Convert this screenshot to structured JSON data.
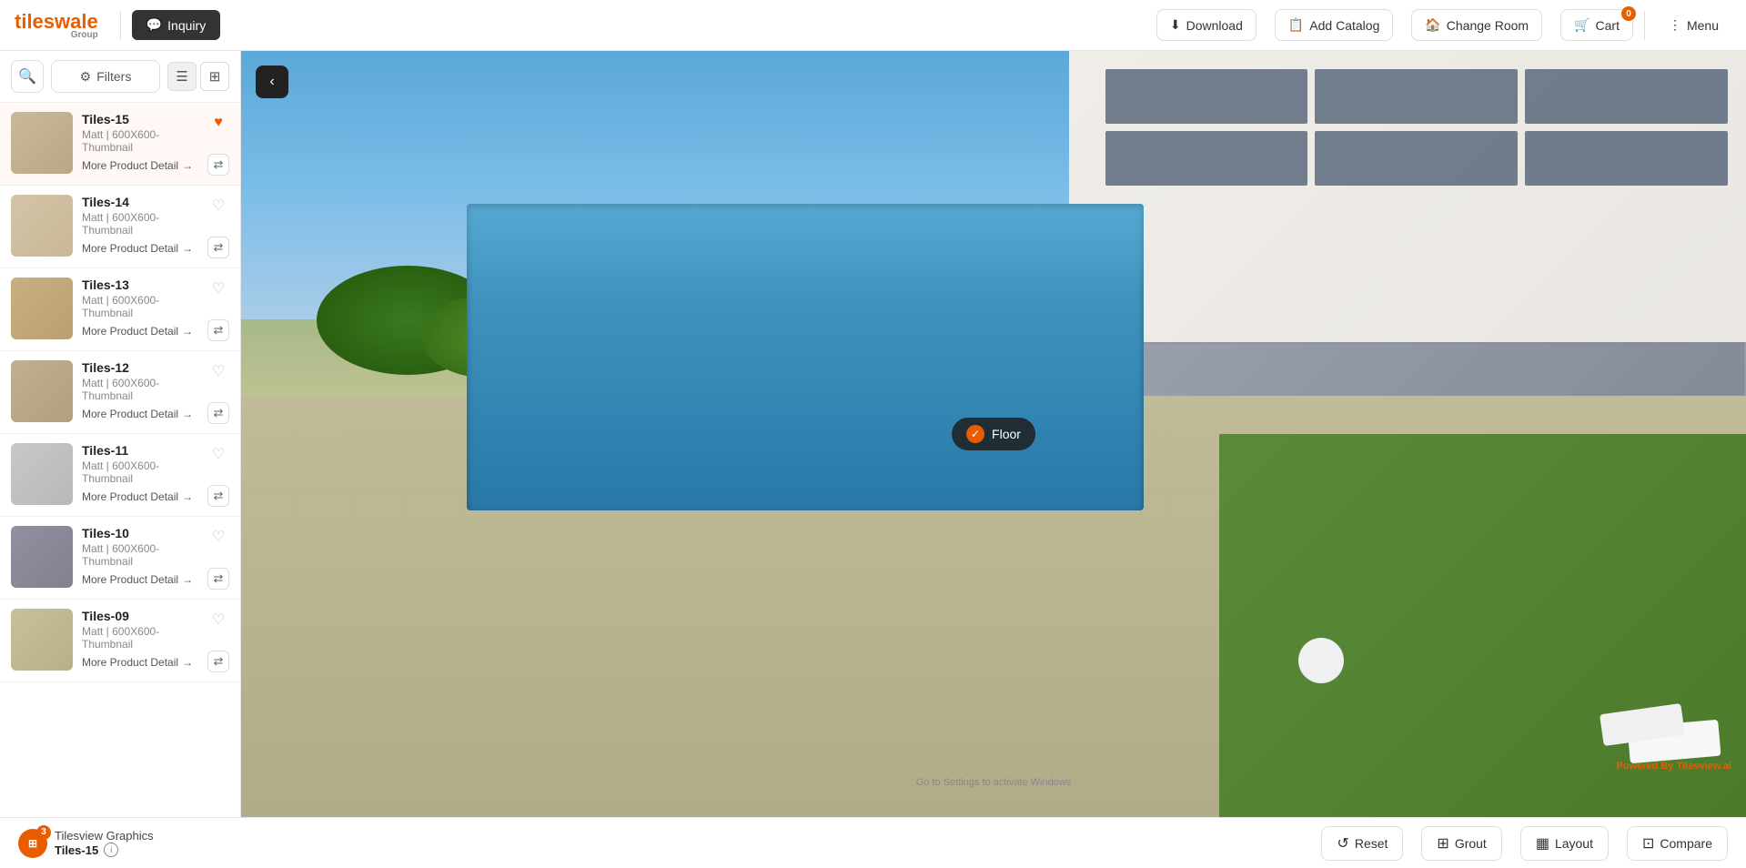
{
  "header": {
    "logo_text_tiles": "tiles",
    "logo_text_wale": "wale",
    "logo_group": "Group",
    "inquiry_label": "Inquiry",
    "download_label": "Download",
    "add_catalog_label": "Add Catalog",
    "change_room_label": "Change Room",
    "cart_label": "Cart",
    "cart_count": "0",
    "menu_label": "Menu"
  },
  "sidebar": {
    "filters_label": "Filters",
    "tiles": [
      {
        "id": "t15",
        "name": "Tiles-15",
        "desc": "Matt | 600X600-Thumbnail",
        "liked": true,
        "color_class": "t15",
        "detail_label": "More Product Detail"
      },
      {
        "id": "t14",
        "name": "Tiles-14",
        "desc": "Matt | 600X600-Thumbnail",
        "liked": false,
        "color_class": "t14",
        "detail_label": "More Product Detail"
      },
      {
        "id": "t13",
        "name": "Tiles-13",
        "desc": "Matt | 600X600-Thumbnail",
        "liked": false,
        "color_class": "t13",
        "detail_label": "More Product Detail"
      },
      {
        "id": "t12",
        "name": "Tiles-12",
        "desc": "Matt | 600X600-Thumbnail",
        "liked": false,
        "color_class": "t12",
        "detail_label": "More Product Detail"
      },
      {
        "id": "t11",
        "name": "Tiles-11",
        "desc": "Matt | 600X600-Thumbnail",
        "liked": false,
        "color_class": "t11",
        "detail_label": "More Product Detail"
      },
      {
        "id": "t10",
        "name": "Tiles-10",
        "desc": "Matt | 600X600-Thumbnail",
        "liked": false,
        "color_class": "t10",
        "detail_label": "More Product Detail"
      },
      {
        "id": "t09",
        "name": "Tiles-09",
        "desc": "Matt | 600X600-Thumbnail",
        "liked": false,
        "color_class": "t09",
        "detail_label": "More Product Detail"
      }
    ]
  },
  "viewer": {
    "floor_label": "Floor",
    "powered_by": "Powered By",
    "powered_brand": "Tilesview.ai",
    "windows_msg": "Go to Settings to activate Windows"
  },
  "bottom_bar": {
    "graphics_label": "Tilesview Graphics",
    "tile_label": "Tiles-15",
    "count": "3",
    "reset_label": "Reset",
    "grout_label": "Grout",
    "layout_label": "Layout",
    "compare_label": "Compare"
  }
}
